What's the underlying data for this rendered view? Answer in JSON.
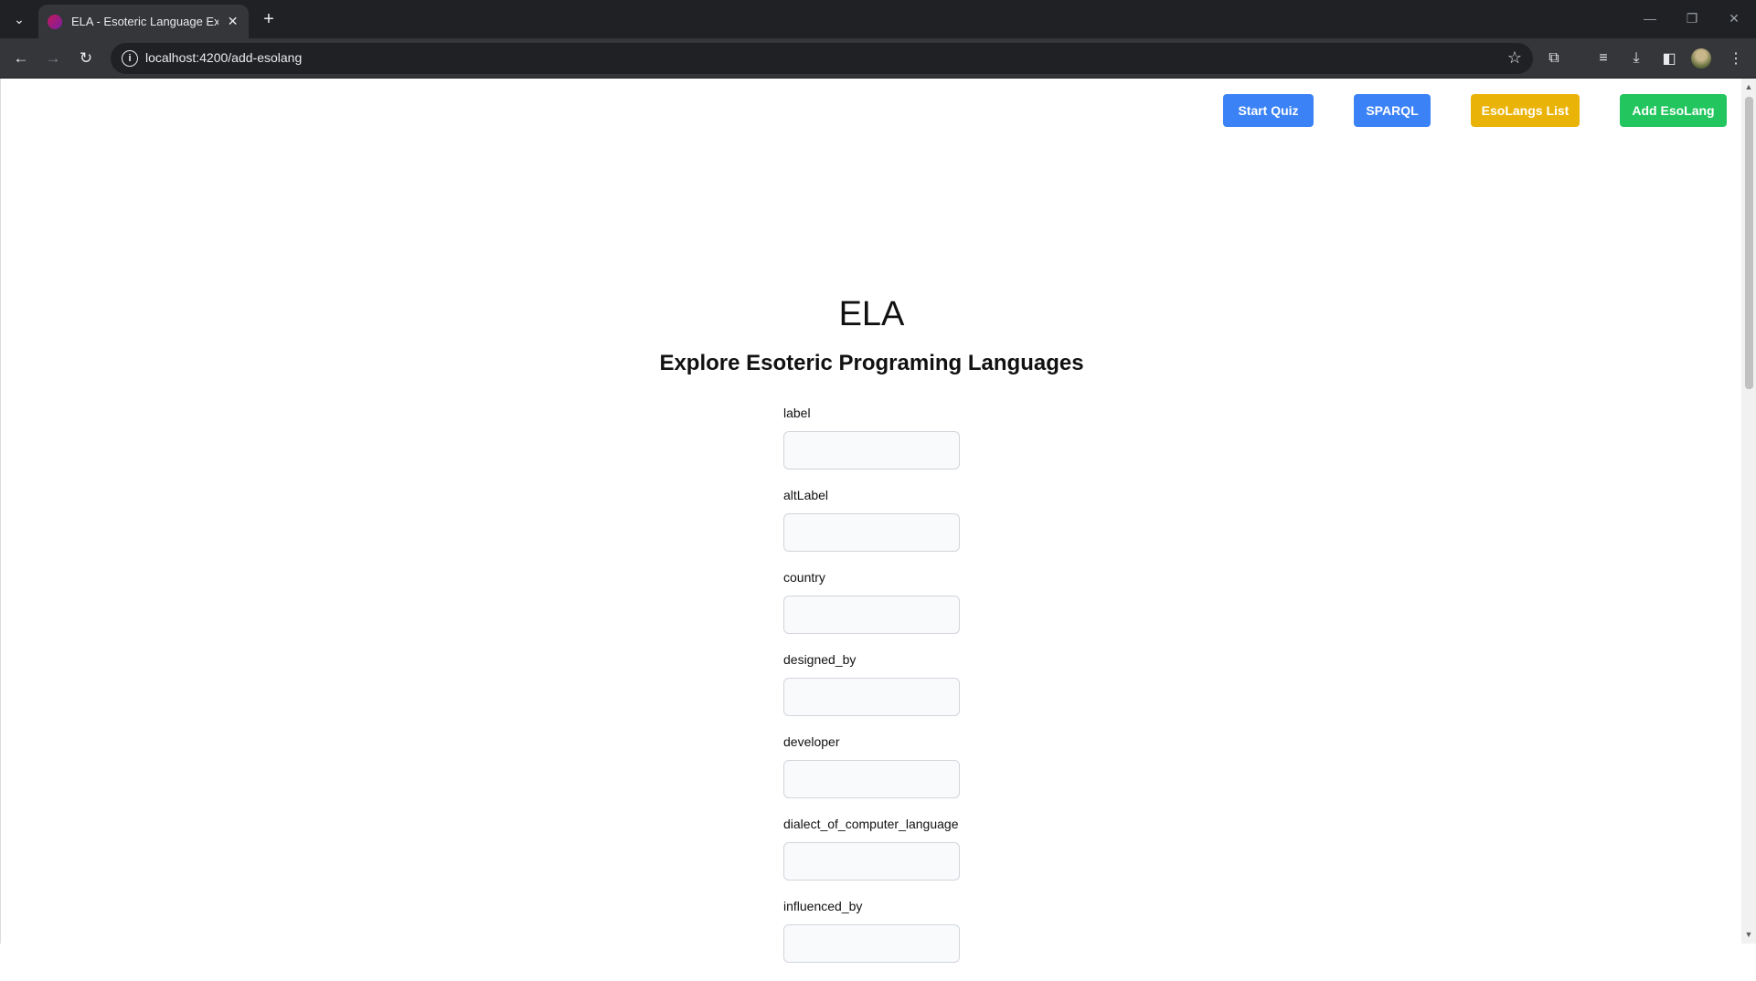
{
  "browser": {
    "tab_title": "ELA - Esoteric Language Explorer",
    "url": "localhost:4200/add-esolang"
  },
  "header": {
    "buttons": [
      {
        "label": "Start Quiz",
        "color": "#3b82f6"
      },
      {
        "label": "SPARQL",
        "color": "#3b82f6"
      },
      {
        "label": "EsoLangs List",
        "color": "#eab308"
      },
      {
        "label": "Add EsoLang",
        "color": "#22c55e"
      }
    ]
  },
  "main": {
    "title": "ELA",
    "subtitle": "Explore Esoteric Programing Languages",
    "fields": [
      {
        "label": "label",
        "value": ""
      },
      {
        "label": "altLabel",
        "value": ""
      },
      {
        "label": "country",
        "value": ""
      },
      {
        "label": "designed_by",
        "value": ""
      },
      {
        "label": "developer",
        "value": ""
      },
      {
        "label": "dialect_of_computer_language",
        "value": ""
      },
      {
        "label": "influenced_by",
        "value": ""
      }
    ]
  }
}
